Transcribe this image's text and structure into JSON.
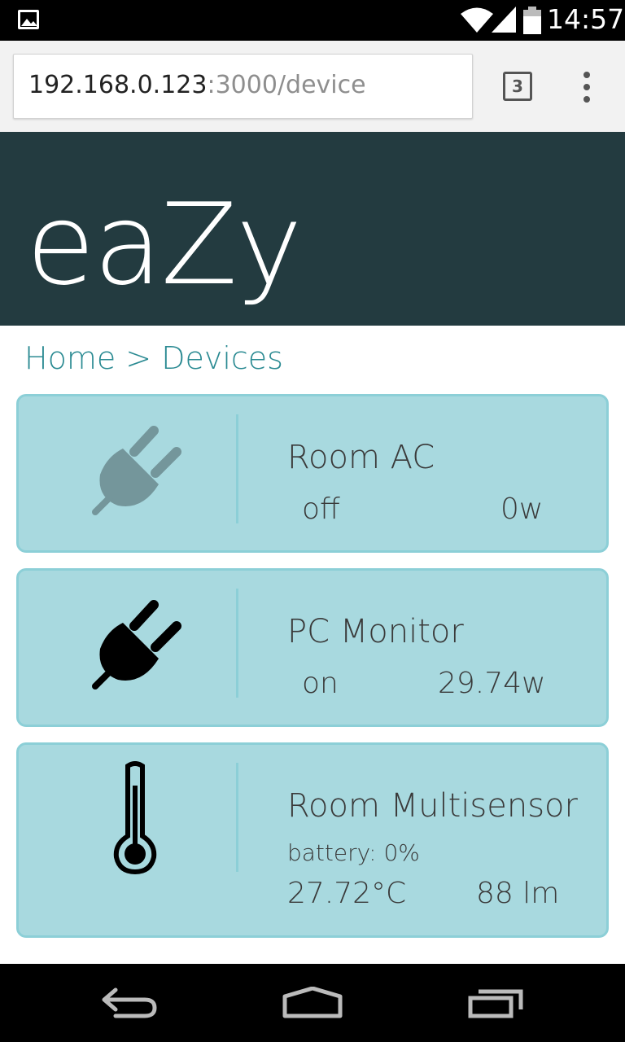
{
  "status_bar": {
    "time": "14:57",
    "icons": [
      "picture-icon",
      "wifi-icon",
      "signal-icon",
      "battery-icon"
    ]
  },
  "browser": {
    "url_host": "192.168.0.123",
    "url_path": ":3000/device",
    "tab_count": "3",
    "icons": [
      "tabs-icon",
      "overflow-menu-icon"
    ]
  },
  "header": {
    "logo": "eaZy",
    "background": "#233b40"
  },
  "breadcrumb": {
    "text": "Home > Devices",
    "color": "#2a8a92"
  },
  "devices": [
    {
      "name": "Room AC",
      "state": "off",
      "power": "0w",
      "icon": "plug-icon",
      "icon_color": "#74969b"
    },
    {
      "name": "PC Monitor",
      "state": "on",
      "power": "29.74w",
      "icon": "plug-icon",
      "icon_color": "#000000"
    },
    {
      "name": "Room Multisensor",
      "battery": "battery: 0%",
      "temperature": "27.72°C",
      "light": "88 lm",
      "icon": "thermometer-icon",
      "icon_color": "#000000"
    }
  ],
  "colors": {
    "card_bg": "#a8d9df",
    "card_border": "#8ccfd7"
  },
  "nav_bar": {
    "icons": [
      "back-icon",
      "home-icon",
      "recents-icon"
    ]
  }
}
